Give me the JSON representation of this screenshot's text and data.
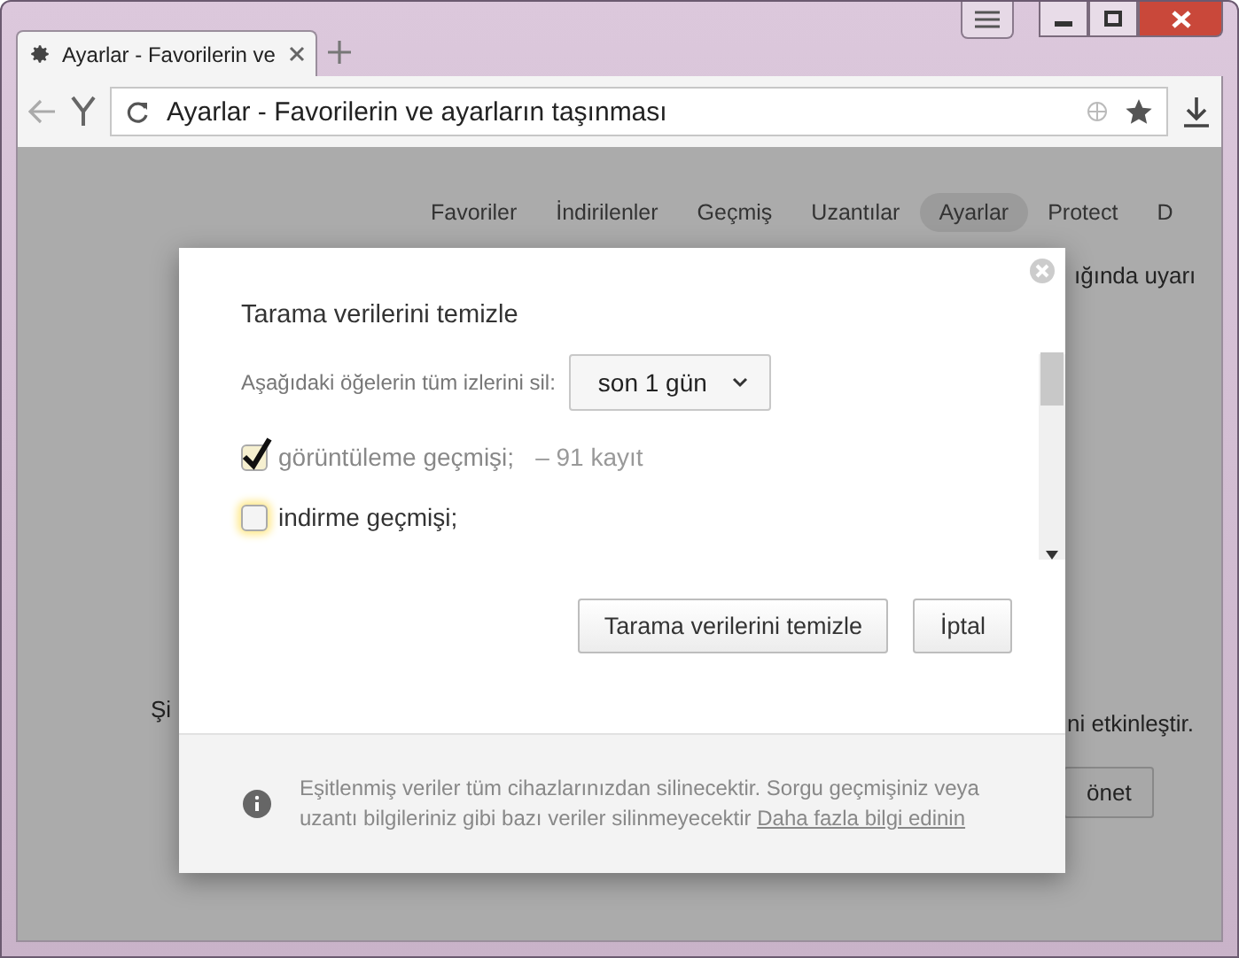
{
  "tab": {
    "title": "Ayarlar - Favorilerin ve"
  },
  "address_bar": {
    "value": "Ayarlar - Favorilerin ve ayarların taşınması"
  },
  "nav": [
    {
      "label": "Favoriler",
      "selected": false
    },
    {
      "label": "İndirilenler",
      "selected": false
    },
    {
      "label": "Geçmiş",
      "selected": false
    },
    {
      "label": "Uzantılar",
      "selected": false
    },
    {
      "label": "Ayarlar",
      "selected": true
    },
    {
      "label": "Protect",
      "selected": false
    },
    {
      "label": "D",
      "selected": false
    }
  ],
  "background": {
    "warning_fragment": "ığında uyarı",
    "section_fragment": "Şi",
    "enable_fragment": "ni etkinleştir.",
    "manage_button": "önet"
  },
  "dialog": {
    "title": "Tarama verilerini temizle",
    "range_label": "Aşağıdaki öğelerin tüm izlerini sil:",
    "range_value": "son 1 gün",
    "items": [
      {
        "label": "görüntüleme geçmişi;",
        "count": "–  91 kayıt",
        "checked": true
      },
      {
        "label": "indirme geçmişi;",
        "checked": false
      }
    ],
    "buttons": [
      "Tarama verilerini temizle",
      "İptal"
    ],
    "info": {
      "text": "Eşitlenmiş veriler tüm cihazlarınızdan silinecektir. Sorgu geçmişiniz veya uzantı bilgileriniz gibi bazı veriler silinmeyecektir",
      "link": "Daha fazla bilgi edinin"
    }
  }
}
